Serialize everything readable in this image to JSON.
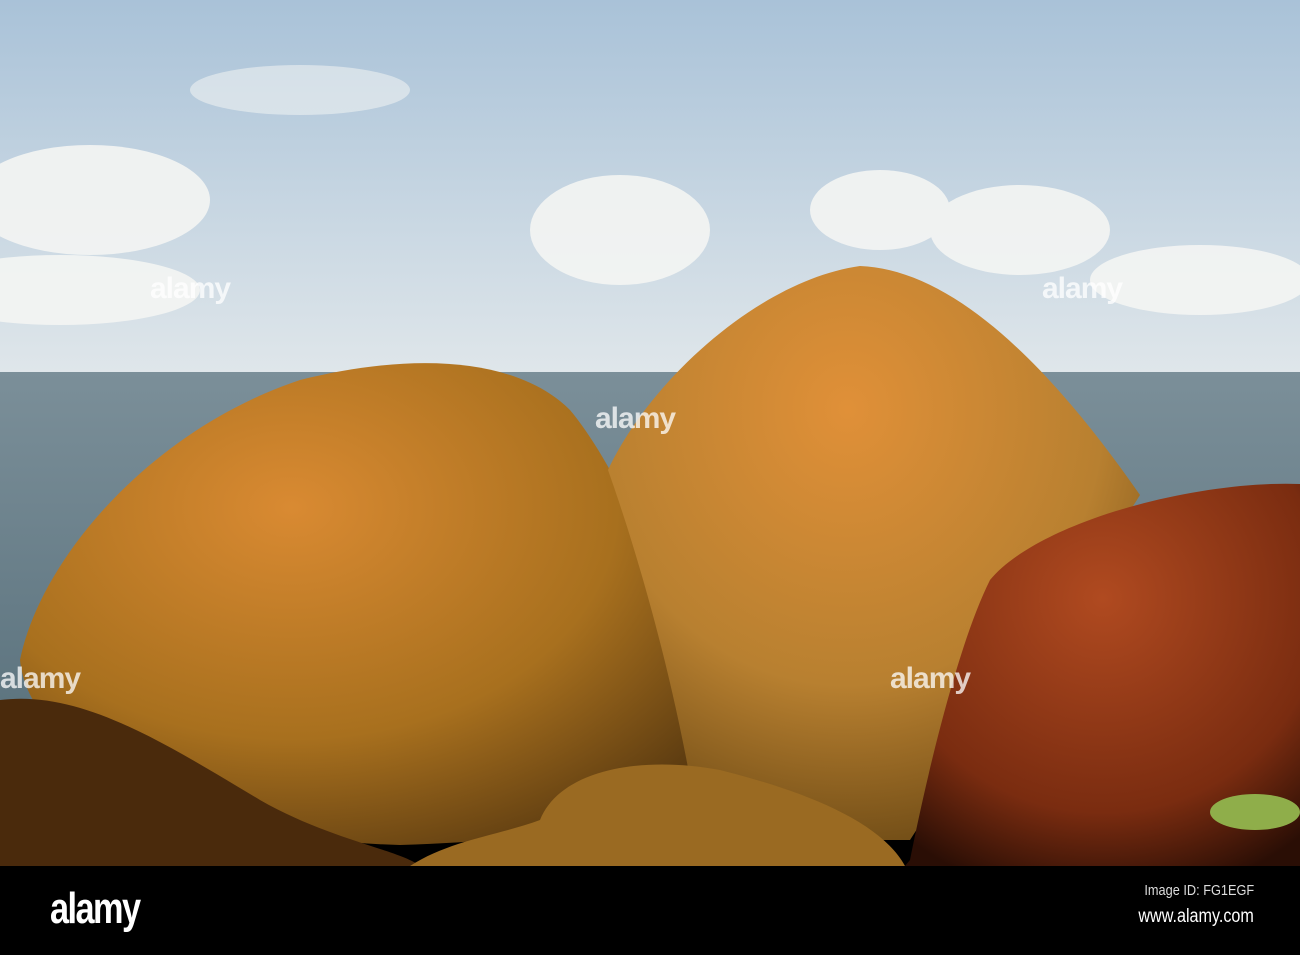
{
  "photo": {
    "subject": "orange lichen-covered boulders by the sea",
    "colors": {
      "sky_top": "#a9c2d8",
      "sky_bottom": "#dfe6ea",
      "sea": "#6f8590",
      "rock": "#c8782a",
      "rock_dark": "#5a3510"
    }
  },
  "watermark": {
    "text": "alamy"
  },
  "footer": {
    "logo": "alamy",
    "image_id": "Image ID: FG1EGF",
    "url": "www.alamy.com"
  }
}
